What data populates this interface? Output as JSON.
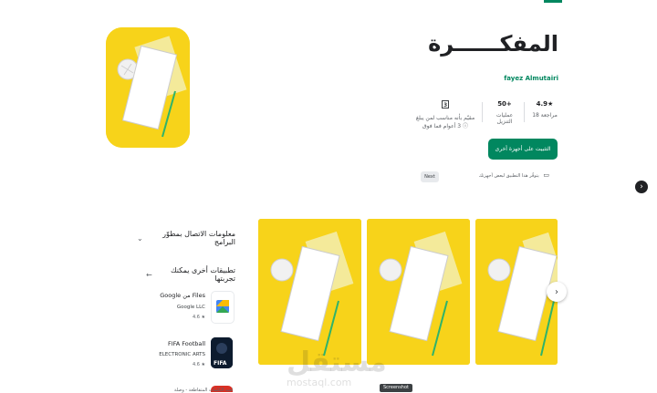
{
  "app": {
    "title": "المفكــــــرة",
    "developer": "fayez Almutairi",
    "stats": [
      {
        "value": "4.9★",
        "label": "18 مراجعة"
      },
      {
        "value": "50+",
        "label": "عمليات التنزيل"
      },
      {
        "value": "",
        "label": "مقيّم بأنه مناسب لمن يبلغ 3 أعوام فما فوق ⓘ"
      }
    ],
    "install_label": "التثبيت على أجهزة أخرى",
    "availability": "يتوفّر هذا التطبيق لبعض أجهزتك"
  },
  "ui": {
    "next_tip": "Next",
    "side_arrow": "›",
    "carousel_arrow": "›",
    "tooltip": "Screenshot"
  },
  "sidebar": {
    "developer_contact": "معلومات الاتصال بمطوّر البرامج",
    "similar_title": "تطبيقات أخرى يمكنك تجربتها",
    "apps": [
      {
        "name": "Files من Google",
        "developer": "Google LLC",
        "rating": "4.6 ★"
      },
      {
        "name": "FIFA Football",
        "developer": "ELECTRONIC ARTS",
        "rating": "4.6 ★"
      }
    ],
    "cut_item": "لعبة الكلمات المتقاطعة - وصلة"
  },
  "watermark": {
    "main": "مستقل",
    "sub": "mostaql.com"
  },
  "colors": {
    "accent": "#01875f",
    "icon_bg": "#f7d31a"
  }
}
